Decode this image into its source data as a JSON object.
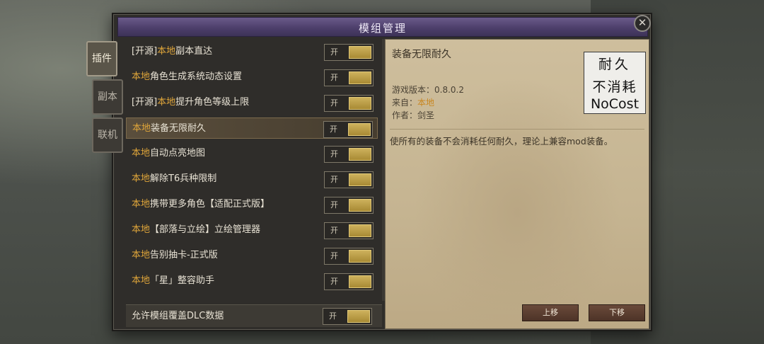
{
  "window": {
    "title": "模组管理"
  },
  "tabs": [
    {
      "label": "插件"
    },
    {
      "label": "副本"
    },
    {
      "label": "联机"
    }
  ],
  "mods": [
    {
      "prefix": "[开源]",
      "source": "本地",
      "name": "副本直达",
      "toggle": "开"
    },
    {
      "prefix": "",
      "source": "本地",
      "name": "角色生成系统动态设置",
      "toggle": "开"
    },
    {
      "prefix": "[开源]",
      "source": "本地",
      "name": "提升角色等级上限",
      "toggle": "开"
    },
    {
      "prefix": "",
      "source": "本地",
      "name": "装备无限耐久",
      "toggle": "开"
    },
    {
      "prefix": "",
      "source": "本地",
      "name": "自动点亮地图",
      "toggle": "开"
    },
    {
      "prefix": "",
      "source": "本地",
      "name": "解除T6兵种限制",
      "toggle": "开"
    },
    {
      "prefix": "",
      "source": "本地",
      "name": "携带更多角色【适配正式版】",
      "toggle": "开"
    },
    {
      "prefix": "",
      "source": "本地",
      "name": "【部落与立绘】立绘管理器",
      "toggle": "开"
    },
    {
      "prefix": "",
      "source": "本地",
      "name": "告别抽卡-正式版",
      "toggle": "开"
    },
    {
      "prefix": "",
      "source": "本地",
      "name": "「星」整容助手",
      "toggle": "开"
    }
  ],
  "dlc_override": {
    "label": "允许模组覆盖DLC数据",
    "toggle": "开"
  },
  "detail": {
    "title": "装备无限耐久",
    "version_label": "游戏版本：",
    "version": "0.8.0.2",
    "source_label": "来自：",
    "source": "本地",
    "author_label": "作者：",
    "author": "剑圣",
    "description": "使所有的装备不会消耗任何耐久，理论上兼容mod装备。",
    "thumbnail": {
      "line1": "耐久",
      "line2": "不消耗",
      "line3": "NoCost"
    }
  },
  "buttons": {
    "move_up": "上移",
    "move_down": "下移",
    "close": "✕"
  }
}
